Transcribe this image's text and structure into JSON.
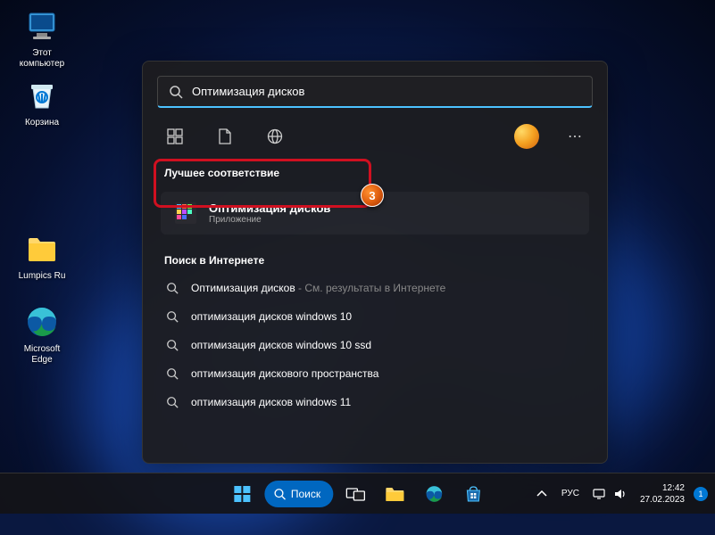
{
  "desktop_icons": [
    {
      "name": "this-pc",
      "label": "Этот\nкомпьютер"
    },
    {
      "name": "recycle-bin",
      "label": "Корзина"
    },
    {
      "name": "lumpics-folder",
      "label": "Lumpics Ru"
    },
    {
      "name": "edge",
      "label": "Microsoft\nEdge"
    }
  ],
  "search": {
    "query": "Оптимизация дисков",
    "best_match_header": "Лучшее соответствие",
    "best_match": {
      "title": "Оптимизация дисков",
      "subtitle": "Приложение"
    },
    "web_header": "Поиск в Интернете",
    "web_results": [
      {
        "text": "Оптимизация дисков",
        "suffix": " - См. результаты в Интернете"
      },
      {
        "text": "оптимизация дисков windows 10",
        "suffix": ""
      },
      {
        "text": "оптимизация дисков windows 10 ssd",
        "suffix": ""
      },
      {
        "text": "оптимизация дискового пространства",
        "suffix": ""
      },
      {
        "text": "оптимизация дисков windows 11",
        "suffix": ""
      }
    ]
  },
  "annotation": {
    "step": "3"
  },
  "taskbar": {
    "search_label": "Поиск",
    "lang": "РУС",
    "time": "12:42",
    "date": "27.02.2023",
    "notif_count": "1"
  }
}
